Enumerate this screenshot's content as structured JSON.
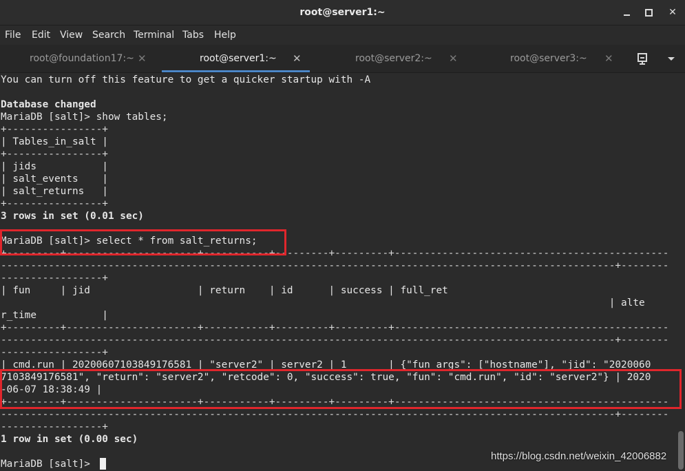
{
  "window": {
    "title": "root@server1:~"
  },
  "menu": [
    "File",
    "Edit",
    "View",
    "Search",
    "Terminal",
    "Tabs",
    "Help"
  ],
  "tabs": [
    {
      "label": "root@foundation17:~",
      "active": false
    },
    {
      "label": "root@server1:~",
      "active": true
    },
    {
      "label": "root@server2:~",
      "active": false
    },
    {
      "label": "root@server3:~",
      "active": false
    }
  ],
  "terminal": {
    "lines": [
      "You can turn off this feature to get a quicker startup with -A",
      "",
      "Database changed",
      "MariaDB [salt]> show tables;",
      "+----------------+",
      "| Tables_in_salt |",
      "+----------------+",
      "| jids           |",
      "| salt_events    |",
      "| salt_returns   |",
      "+----------------+",
      "3 rows in set (0.01 sec)",
      "",
      "MariaDB [salt]> select * from salt_returns;",
      "+---------+----------------------+-----------+---------+---------+----------------------------------------------",
      "-------------------------------------------------------------------------------------------------------+--------",
      "-----------------+",
      "| fun     | jid                  | return    | id      | success | full_ret",
      "                                                                                                      | alte",
      "r_time           |",
      "+---------+----------------------+-----------+---------+---------+----------------------------------------------",
      "-------------------------------------------------------------------------------------------------------+--------",
      "-----------------+",
      "| cmd.run | 20200607103849176581 | \"server2\" | server2 | 1       | {\"fun_args\": [\"hostname\"], \"jid\": \"2020060",
      "7103849176581\", \"return\": \"server2\", \"retcode\": 0, \"success\": true, \"fun\": \"cmd.run\", \"id\": \"server2\"} | 2020",
      "-06-07 18:38:49 |",
      "+---------+----------------------+-----------+---------+---------+----------------------------------------------",
      "-------------------------------------------------------------------------------------------------------+--------",
      "-----------------+",
      "1 row in set (0.00 sec)",
      "",
      "MariaDB [salt]> "
    ]
  },
  "watermark": "https://blog.csdn.net/weixin_42006882"
}
